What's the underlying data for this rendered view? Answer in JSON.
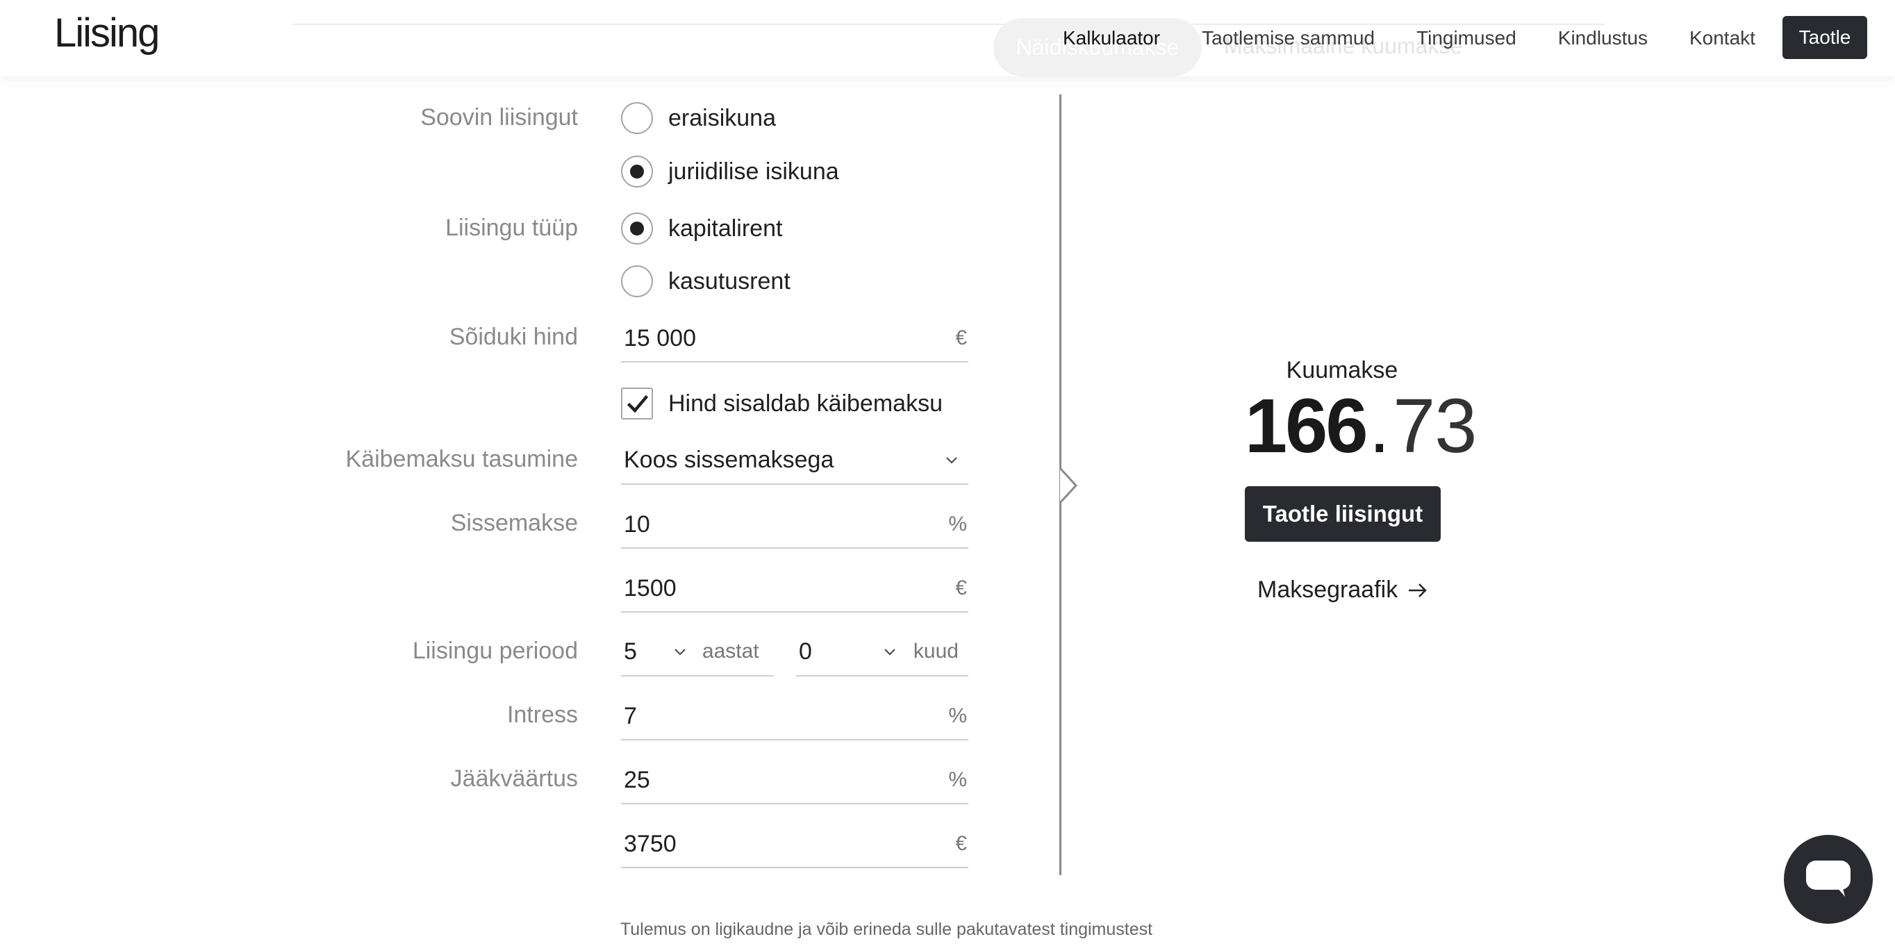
{
  "header": {
    "logo": "Liising",
    "tabs": [
      {
        "label": "Näidiskuumakse",
        "active": true
      },
      {
        "label": "Maksimaalne kuumakse",
        "active": false
      }
    ],
    "nav": [
      {
        "label": "Kalkulaator",
        "active": true
      },
      {
        "label": "Taotlemise sammud",
        "active": false
      },
      {
        "label": "Tingimused",
        "active": false
      },
      {
        "label": "Kindlustus",
        "active": false
      },
      {
        "label": "Kontakt",
        "active": false
      }
    ],
    "apply_label": "Taotle"
  },
  "form": {
    "wish": {
      "label": "Soovin liisingut",
      "options": [
        {
          "label": "eraisikuna",
          "checked": false
        },
        {
          "label": "juriidilise isikuna",
          "checked": true
        }
      ]
    },
    "lease_type": {
      "label": "Liisingu tüüp",
      "options": [
        {
          "label": "kapitalirent",
          "checked": true
        },
        {
          "label": "kasutusrent",
          "checked": false
        }
      ]
    },
    "vehicle_price": {
      "label": "Sõiduki hind",
      "value": "15 000",
      "unit": "€"
    },
    "vat_included": {
      "label": "Hind sisaldab käibemaksu",
      "checked": true
    },
    "vat_payment": {
      "label": "Käibemaksu tasumine",
      "value": "Koos sissemaksega"
    },
    "down_payment": {
      "label": "Sissemakse",
      "percent": "10",
      "percent_unit": "%",
      "amount": "1500",
      "amount_unit": "€"
    },
    "period": {
      "label": "Liisingu periood",
      "years": "5",
      "years_unit": "aastat",
      "months": "0",
      "months_unit": "kuud"
    },
    "interest": {
      "label": "Intress",
      "value": "7",
      "unit": "%"
    },
    "residual": {
      "label": "Jääkväärtus",
      "percent": "25",
      "percent_unit": "%",
      "amount": "3750",
      "amount_unit": "€"
    }
  },
  "result": {
    "label": "Kuumakse",
    "integer": "166",
    "separator": ".",
    "decimals": "73",
    "apply_label": "Taotle liisingut",
    "schedule_label": "Maksegraafik"
  },
  "disclaimer": "Tulemus on ligikaudne ja võib erineda sulle pakutavatest tingimustest",
  "colors": {
    "accent": "#2a2b30",
    "label": "#8a8a8a",
    "divider": "#8a8a8a"
  }
}
